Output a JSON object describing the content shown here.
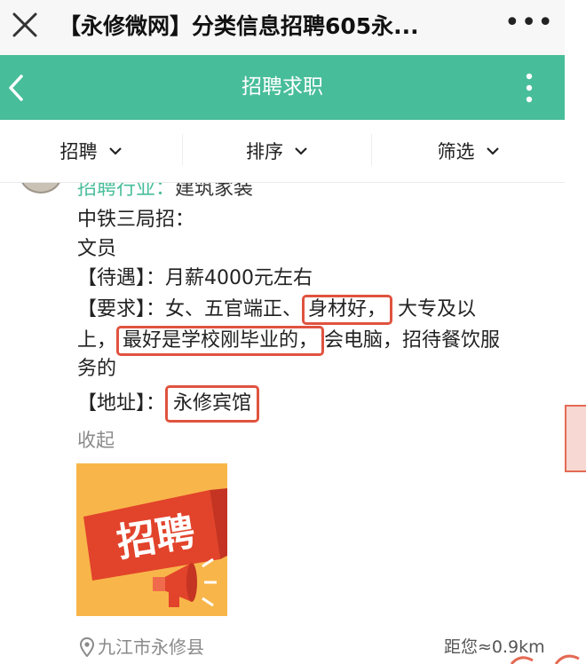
{
  "browser": {
    "title": "【永修微网】分类信息招聘605永...",
    "more": "•••"
  },
  "header": {
    "title": "招聘求职",
    "accent_color": "#48bd9a"
  },
  "filters": [
    {
      "label": "招聘"
    },
    {
      "label": "排序"
    },
    {
      "label": "筛选"
    }
  ],
  "post": {
    "industry_label": "招聘行业：",
    "industry_value": "建筑家装",
    "company": "中铁三局招：",
    "position": "文员",
    "salary_label": "【待遇】：",
    "salary_value": "月薪4000元左右",
    "req_label": "【要求】：",
    "req_part1": "女、五官端正、",
    "req_highlight1": "身材好，",
    "req_part2": "大专及以",
    "req_part3": "上，",
    "req_highlight2": "最好是学校刚毕业的，",
    "req_part4": "会电脑，招待餐饮服",
    "req_part5": "务的",
    "address_label": "【地址】：",
    "address_value": "永修宾馆",
    "highlight_color": "#e0533f",
    "collapse": "收起",
    "image_text": "招聘",
    "location": "九江市永修县",
    "distance": "距您≈0.9km"
  }
}
